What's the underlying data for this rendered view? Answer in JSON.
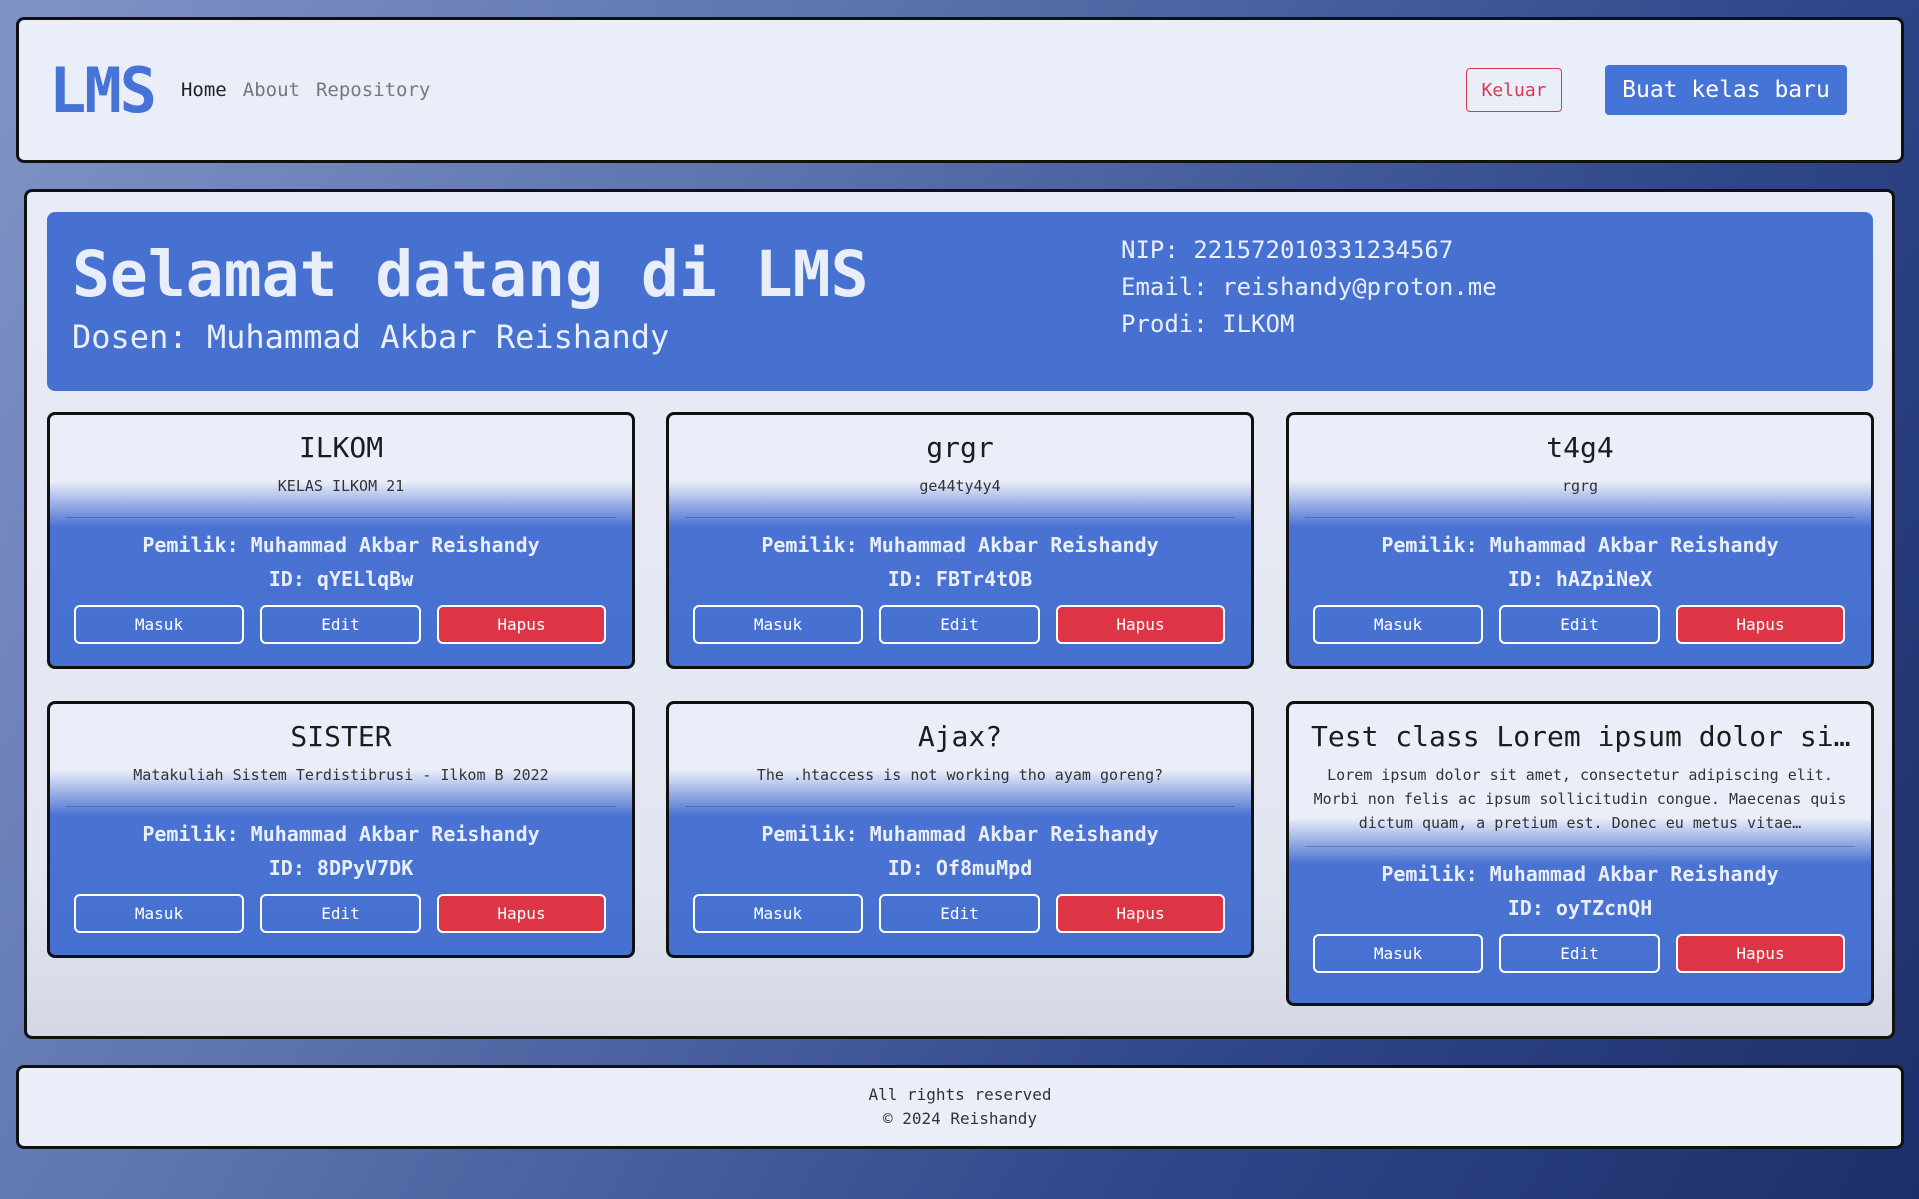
{
  "header": {
    "logo": "LMS",
    "nav": [
      "Home",
      "About",
      "Repository"
    ],
    "logout_label": "Keluar",
    "create_label": "Buat kelas baru"
  },
  "welcome": {
    "title": "Selamat datang di LMS",
    "subtitle": "Dosen: Muhammad Akbar Reishandy",
    "nip": "NIP: 221572010331234567",
    "email": "Email: reishandy@proton.me",
    "prodi": "Prodi: ILKOM"
  },
  "buttons": {
    "enter": "Masuk",
    "edit": "Edit",
    "delete": "Hapus"
  },
  "classes": [
    {
      "title": "ILKOM",
      "desc": "KELAS ILKOM 21",
      "owner": "Pemilik: Muhammad Akbar Reishandy",
      "id": "ID: qYELlqBw"
    },
    {
      "title": "grgr",
      "desc": "ge44ty4y4",
      "owner": "Pemilik: Muhammad Akbar Reishandy",
      "id": "ID: FBTr4tOB"
    },
    {
      "title": "t4g4",
      "desc": "rgrg",
      "owner": "Pemilik: Muhammad Akbar Reishandy",
      "id": "ID: hAZpiNeX"
    },
    {
      "title": "SISTER",
      "desc": "Matakuliah Sistem Terdistibrusi - Ilkom B 2022",
      "owner": "Pemilik: Muhammad Akbar Reishandy",
      "id": "ID: 8DPyV7DK"
    },
    {
      "title": "Ajax?",
      "desc": "The .htaccess is not working tho ayam goreng?",
      "owner": "Pemilik: Muhammad Akbar Reishandy",
      "id": "ID: Of8muMpd"
    },
    {
      "title": "Test class Lorem ipsum dolor si…",
      "desc": "Lorem ipsum dolor sit amet, consectetur adipiscing elit. Morbi non felis ac ipsum sollicitudin congue. Maecenas quis dictum quam, a pretium est. Donec eu metus vitae…",
      "owner": "Pemilik: Muhammad Akbar Reishandy",
      "id": "ID: oyTZcnQH"
    }
  ],
  "footer": {
    "line1": "All rights reserved",
    "line2": "© 2024 Reishandy"
  }
}
